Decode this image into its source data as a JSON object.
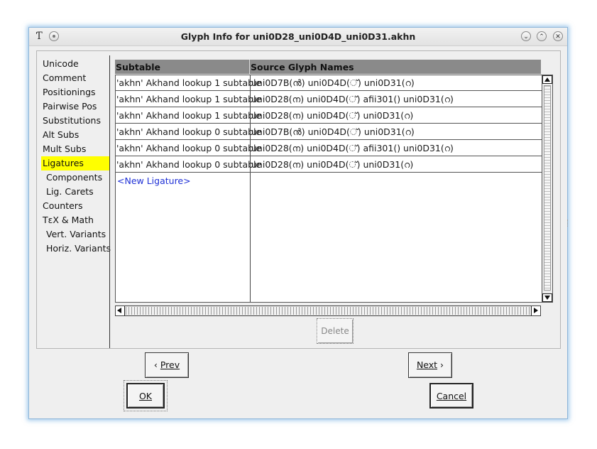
{
  "window": {
    "title": "Glyph Info for uni0D28_uni0D4D_uni0D31.akhn"
  },
  "sidebar": {
    "items": [
      {
        "label": "Unicode",
        "sub": false,
        "selected": false
      },
      {
        "label": "Comment",
        "sub": false,
        "selected": false
      },
      {
        "label": "Positionings",
        "sub": false,
        "selected": false
      },
      {
        "label": "Pairwise Pos",
        "sub": false,
        "selected": false
      },
      {
        "label": "Substitutions",
        "sub": false,
        "selected": false
      },
      {
        "label": "Alt Subs",
        "sub": false,
        "selected": false
      },
      {
        "label": "Mult Subs",
        "sub": false,
        "selected": false
      },
      {
        "label": "Ligatures",
        "sub": false,
        "selected": true
      },
      {
        "label": "Components",
        "sub": true,
        "selected": false
      },
      {
        "label": "Lig. Carets",
        "sub": true,
        "selected": false
      },
      {
        "label": "Counters",
        "sub": false,
        "selected": false
      },
      {
        "label": "TεX & Math",
        "sub": false,
        "selected": false
      },
      {
        "label": "Vert. Variants",
        "sub": true,
        "selected": false
      },
      {
        "label": "Horiz. Variants",
        "sub": true,
        "selected": false
      }
    ],
    "selected_color": "#ffff00"
  },
  "table": {
    "headers": [
      "Subtable",
      "Source Glyph Names"
    ],
    "rows": [
      {
        "subtable": "'akhn' Akhand lookup 1 subtable",
        "glyphs": "uni0D7B(ൻ) uni0D4D(്) uni0D31(റ)"
      },
      {
        "subtable": "'akhn' Akhand lookup 1 subtable",
        "glyphs": "uni0D28(ന) uni0D4D(്) afii301() uni0D31(റ)"
      },
      {
        "subtable": "'akhn' Akhand lookup 1 subtable",
        "glyphs": "uni0D28(ന) uni0D4D(്) uni0D31(റ)"
      },
      {
        "subtable": "'akhn' Akhand lookup 0 subtable",
        "glyphs": "uni0D7B(ൻ) uni0D4D(്) uni0D31(റ)"
      },
      {
        "subtable": "'akhn' Akhand lookup 0 subtable",
        "glyphs": "uni0D28(ന) uni0D4D(്) afii301() uni0D31(റ)"
      },
      {
        "subtable": "'akhn' Akhand lookup 0 subtable",
        "glyphs": "uni0D28(ന) uni0D4D(്) uni0D31(റ)"
      }
    ],
    "new_entry_label": "<New Ligature>",
    "header_color": "#8a8a8a",
    "new_entry_color": "#1d2fd6"
  },
  "buttons": {
    "delete": "Delete",
    "prev": "Prev",
    "prev_arrow": "‹",
    "next": "Next",
    "next_arrow": "›",
    "ok": "OK",
    "cancel": "Cancel"
  },
  "icons": {
    "app": "fontforge-icon",
    "pin": "pin-icon",
    "minimize": "chevron-down-icon",
    "maximize": "chevron-up-icon",
    "close": "close-icon"
  }
}
